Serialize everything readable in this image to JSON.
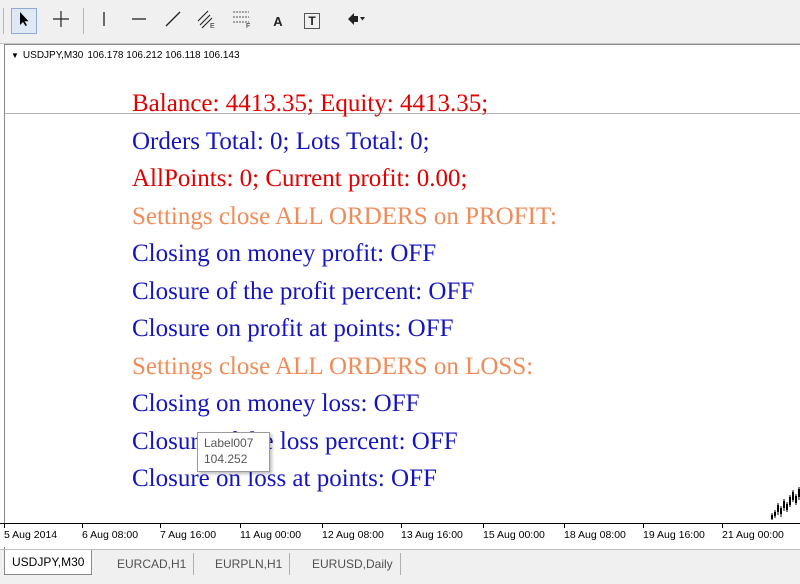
{
  "toolbar": {
    "tools": [
      {
        "name": "cursor-icon"
      },
      {
        "name": "crosshair-icon"
      },
      {
        "name": "vertical-line-icon"
      },
      {
        "name": "horizontal-line-icon"
      },
      {
        "name": "trendline-icon"
      },
      {
        "name": "equidistant-channel-icon"
      },
      {
        "name": "fibonacci-retracement-icon"
      },
      {
        "name": "text-icon",
        "glyph": "A"
      },
      {
        "name": "text-label-icon",
        "glyph": "T"
      },
      {
        "name": "arrows-icon"
      }
    ]
  },
  "chart": {
    "symbol_info": "USDJPY,M30",
    "ohlc": "106.178 106.212 106.118 106.143",
    "lines": [
      {
        "text": "Balance: 4413.35; Equity: 4413.35;",
        "color": "#e00000"
      },
      {
        "text": "Orders Total: 0; Lots Total: 0;",
        "color": "#1515c0"
      },
      {
        "text": "AllPoints: 0; Current profit: 0.00;",
        "color": "#e00000"
      },
      {
        "text": "Settings close ALL ORDERS on PROFIT:",
        "color": "#f08c5a"
      },
      {
        "text": "Closing on money profit: OFF",
        "color": "#1515c0"
      },
      {
        "text": "Closure of the profit percent: OFF",
        "color": "#1515c0"
      },
      {
        "text": "Closure on profit at points: OFF",
        "color": "#1515c0"
      },
      {
        "text": "Settings close ALL ORDERS on LOSS:",
        "color": "#f08c5a"
      },
      {
        "text": "Closing on money loss: OFF",
        "color": "#1515c0"
      },
      {
        "text": "Closure of the loss percent: OFF",
        "color": "#1515c0"
      },
      {
        "text": "Closure on loss at points: OFF",
        "color": "#1515c0"
      }
    ],
    "tooltip": {
      "name": "Label007",
      "value": "104.252"
    }
  },
  "time_axis": [
    "5 Aug 2014",
    "6 Aug 08:00",
    "7 Aug 16:00",
    "11 Aug 00:00",
    "12 Aug 08:00",
    "13 Aug 16:00",
    "15 Aug 00:00",
    "18 Aug 08:00",
    "19 Aug 16:00",
    "21 Aug 00:00"
  ],
  "tabs": [
    {
      "label": "USDJPY,M30",
      "active": true
    },
    {
      "label": "EURCAD,H1",
      "active": false
    },
    {
      "label": "EURPLN,H1",
      "active": false
    },
    {
      "label": "EURUSD,Daily",
      "active": false
    }
  ]
}
